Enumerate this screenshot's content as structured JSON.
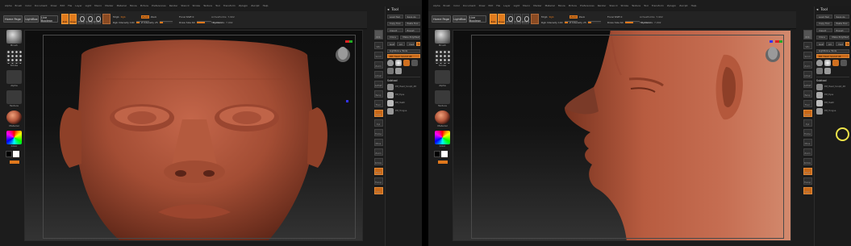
{
  "menu_items": [
    "Alpha",
    "Brush",
    "Color",
    "Document",
    "Draw",
    "Edit",
    "File",
    "Layer",
    "Light",
    "Macro",
    "Marker",
    "Material",
    "Movie",
    "Picture",
    "Preferences",
    "Render",
    "Stencil",
    "Stroke",
    "Texture",
    "Tool",
    "Transform",
    "Zplugin",
    "Zscript",
    "Help"
  ],
  "panes": [
    {
      "id": "A",
      "toolbar": {
        "mode1": "Home Page",
        "mode2": "LightBox",
        "mode3": "Live Boolean",
        "edit": "Edit",
        "draw": "Draw",
        "move": "Move",
        "scale": "Scale",
        "rotate": "Rotate",
        "mrgb": "Mrgb",
        "rgb": "Rgb",
        "m": "M",
        "zadd": "Zadd",
        "zsub": "Zsub",
        "focal_label": "Focal Shift 0",
        "intensity_label": "Z Intensity 25",
        "draw_size_label": "Draw Size 64",
        "dynamic": "Dynamic",
        "active_points": "ActivePoints: 7,902",
        "total_points": "TotalPoints: 7,902",
        "rgb_intensity": "Rgb Intensity 100"
      },
      "panel": {
        "title": "Tool",
        "load": "Load Tool",
        "save": "Save As",
        "copy": "Copy Tool",
        "paste": "Paste Tool",
        "import": "Import",
        "export": "Export",
        "clone": "Clone",
        "make_poly": "Make PolyMesh3D",
        "goz": "GoZ",
        "all": "All",
        "visible": "Visible",
        "r": "R",
        "lightbox": "Lightbox ▸ Tools",
        "current": "PM_Head_Sculpt 48",
        "subtool": "Subtool",
        "list": [
          "PM_Head_Sculpt_48",
          "PM_Eyes",
          "PM_Teeth",
          "PM_Tongue"
        ]
      },
      "fill": {
        "range": 0.25,
        "intensity": 0.25,
        "drawsize": 0.55
      }
    },
    {
      "id": "B",
      "toolbar": {
        "mode1": "Home Page",
        "mode2": "LightBox",
        "mode3": "Live Boolean",
        "edit": "Edit",
        "draw": "Draw",
        "move": "Move",
        "scale": "Scale",
        "rotate": "Rotate",
        "mrgb": "Mrgb",
        "rgb": "Rgb",
        "m": "M",
        "zadd": "Zadd",
        "zsub": "Zsub",
        "focal_label": "Focal Shift 0",
        "intensity_label": "Z Intensity 25",
        "draw_size_label": "Draw Size 64",
        "dynamic": "Dynamic",
        "active_points": "ActivePoints: 7,902",
        "total_points": "TotalPoints: 7,902",
        "rgb_intensity": "Rgb Intensity 100"
      },
      "panel": {
        "title": "Tool",
        "load": "Load Tool",
        "save": "Save As",
        "copy": "Copy Tool",
        "paste": "Paste Tool",
        "import": "Import",
        "export": "Export",
        "clone": "Clone",
        "make_poly": "Make PolyMesh3D",
        "goz": "GoZ",
        "all": "All",
        "visible": "Visible",
        "r": "R",
        "lightbox": "Lightbox ▸ Tools",
        "current": "PM_Head_Sculpt 48",
        "subtool": "Subtool",
        "list": [
          "PM_Head_Sculpt_48",
          "PM_Eyes",
          "PM_Teeth",
          "PM_Tongue"
        ]
      },
      "fill": {
        "range": 0.25,
        "intensity": 0.25,
        "drawsize": 0.55
      }
    }
  ],
  "shelf": [
    {
      "label": "Brush"
    },
    {
      "label": "Stroke"
    },
    {
      "label": "Alpha"
    },
    {
      "label": "Texture"
    },
    {
      "label": "Material"
    },
    {
      "label": "Gradient"
    },
    {
      "label": "Color"
    }
  ],
  "colors": {
    "accent": "#e0781c",
    "skin": "#b0553a",
    "background": "#1c1c1c",
    "highlight": "#ede34a"
  }
}
